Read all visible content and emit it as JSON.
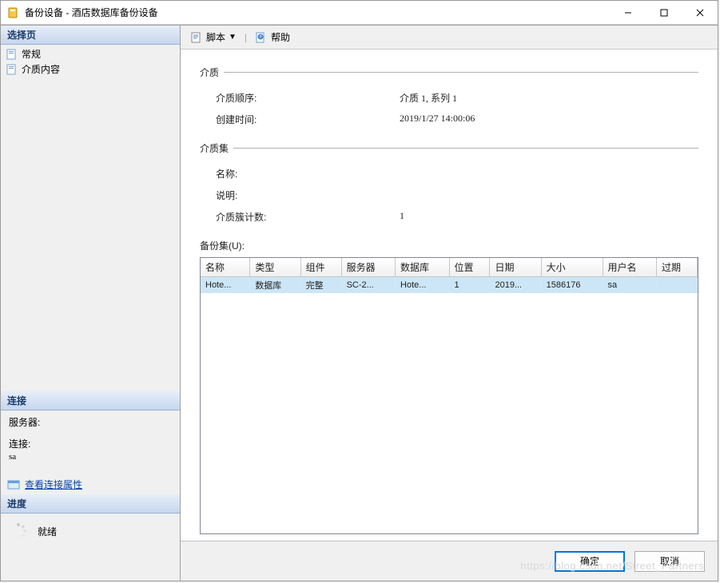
{
  "window": {
    "title": "备份设备 - 酒店数据库备份设备"
  },
  "sidebar": {
    "select_page_header": "选择页",
    "items": [
      {
        "label": "常规"
      },
      {
        "label": "介质内容"
      }
    ],
    "connection_header": "连接",
    "server_label": "服务器:",
    "server_value": "",
    "conn_label": "连接:",
    "conn_value": "sa",
    "view_conn_props": "查看连接属性",
    "progress_header": "进度",
    "status": "就绪"
  },
  "toolbar": {
    "script_label": "脚本",
    "help_label": "帮助"
  },
  "main": {
    "media_group": "介质",
    "media_sequence_label": "介质顺序:",
    "media_sequence_value": "介质 1, 系列 1",
    "created_label": "创建时间:",
    "created_value": "2019/1/27 14:00:06",
    "mediaset_group": "介质集",
    "name_label": "名称:",
    "name_value": "",
    "desc_label": "说明:",
    "desc_value": "",
    "family_count_label": "介质簇计数:",
    "family_count_value": "1",
    "backupset_label": "备份集(U):"
  },
  "table": {
    "columns": [
      "名称",
      "类型",
      "组件",
      "服务器",
      "数据库",
      "位置",
      "日期",
      "大小",
      "用户名",
      "过期"
    ],
    "rows": [
      {
        "name": "Hote...",
        "type": "数据库",
        "component": "完整",
        "server": "SC-2...",
        "database": "Hote...",
        "position": "1",
        "date": "2019...",
        "size": "1586176",
        "user": "sa",
        "expire": ""
      }
    ]
  },
  "footer": {
    "ok": "确定",
    "cancel": "取消"
  },
  "watermark": "https://blog.csdn.net/Street_Partners"
}
